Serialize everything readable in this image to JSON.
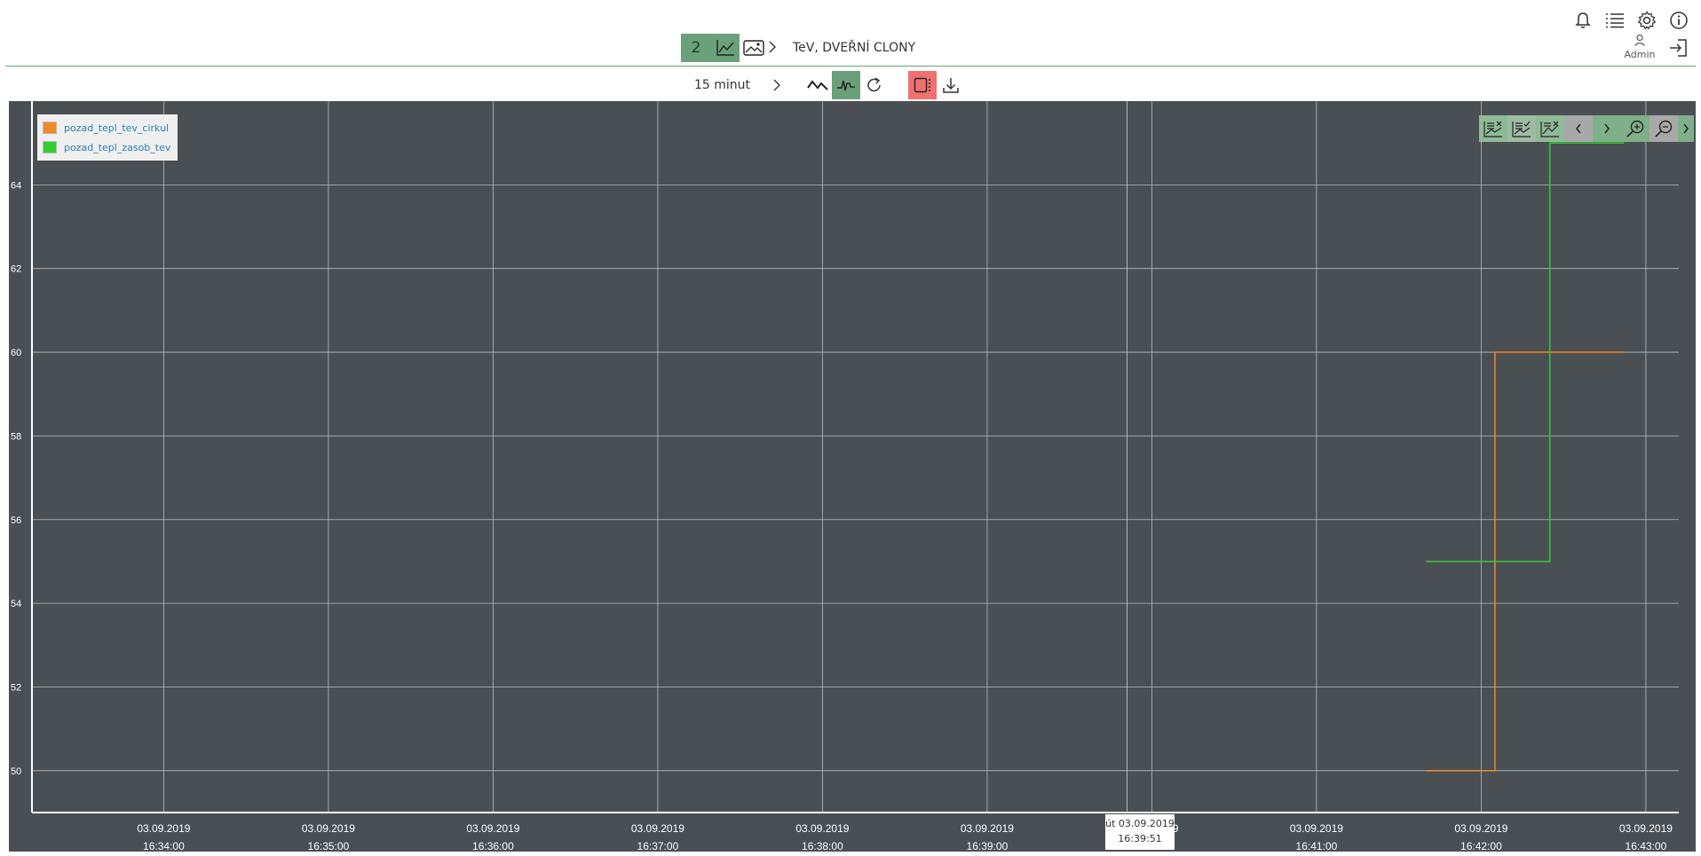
{
  "header": {
    "badge_number": "2",
    "title": "TeV, DVEŘNÍ CLONY",
    "user_name": "Admin"
  },
  "toolbar": {
    "period_label": "15 minut"
  },
  "legend": {
    "items": [
      {
        "label": "pozad_tepl_tev_cirkul",
        "color": "#f08a24"
      },
      {
        "label": "pozad_tepl_zasob_tev",
        "color": "#33cc33"
      }
    ]
  },
  "tooltip": {
    "date": "út 03.09.2019",
    "time": "16:39:51"
  },
  "colors": {
    "accent": "#6aa17a",
    "danger": "#f07070",
    "chart_bg": "#4a4f54"
  },
  "chart_data": {
    "type": "line",
    "step": true,
    "grid": true,
    "legend_position": "top-left",
    "x_ticks": [
      {
        "date": "03.09.2019",
        "time": "16:34:00"
      },
      {
        "date": "03.09.2019",
        "time": "16:35:00"
      },
      {
        "date": "03.09.2019",
        "time": "16:36:00"
      },
      {
        "date": "03.09.2019",
        "time": "16:37:00"
      },
      {
        "date": "03.09.2019",
        "time": "16:38:00"
      },
      {
        "date": "03.09.2019",
        "time": "16:39:00"
      },
      {
        "date": "03.09.2019",
        "time": "16:40:00"
      },
      {
        "date": "03.09.2019",
        "time": "16:41:00"
      },
      {
        "date": "03.09.2019",
        "time": "16:42:00"
      },
      {
        "date": "03.09.2019",
        "time": "16:43:00"
      }
    ],
    "y_tick_labels": [
      "50",
      "52",
      "54",
      "56",
      "58",
      "60",
      "62",
      "64"
    ],
    "y_ticks": [
      50,
      52,
      54,
      56,
      58,
      60,
      62,
      64
    ],
    "xlim": [
      "16:33:12",
      "16:43:12"
    ],
    "ylim": [
      49.0,
      66.0
    ],
    "cursor_time": "16:39:51",
    "series": [
      {
        "name": "pozad_tepl_tev_cirkul",
        "color": "#f08a24",
        "points": [
          [
            "16:41:40",
            50
          ],
          [
            "16:42:05",
            50
          ],
          [
            "16:42:05",
            60
          ],
          [
            "16:42:52",
            60
          ]
        ]
      },
      {
        "name": "pozad_tepl_zasob_tev",
        "color": "#33cc33",
        "points": [
          [
            "16:41:40",
            55
          ],
          [
            "16:42:25",
            55
          ],
          [
            "16:42:25",
            65
          ],
          [
            "16:42:52",
            65
          ]
        ]
      }
    ]
  }
}
